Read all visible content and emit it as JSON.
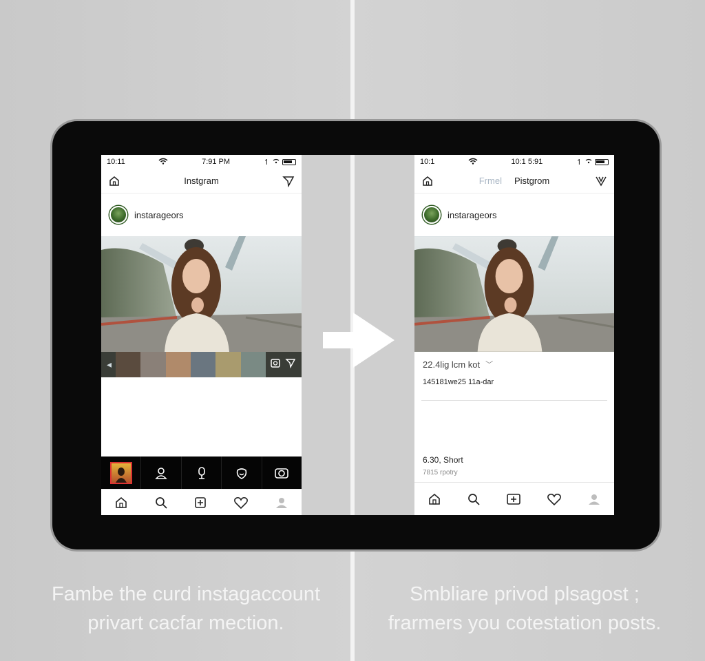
{
  "left_phone": {
    "status": {
      "time_left": "10:11",
      "time_center": "7:91 PM"
    },
    "appbar": {
      "title": "Instgram"
    },
    "profile": {
      "username": "instarageors"
    },
    "icons": {
      "home": "home-icon",
      "send": "send-icon"
    },
    "bottom_nav": [
      "home-icon",
      "search-icon",
      "add-post-icon",
      "heart-icon",
      "profile-icon"
    ],
    "story_bar": [
      "story-thumb",
      "person-icon",
      "mic-icon",
      "smile-icon",
      "camera-icon"
    ]
  },
  "right_phone": {
    "status": {
      "time_left": "10:1",
      "time_center": "10:1 5:91"
    },
    "appbar": {
      "tab_inactive": "Frmel",
      "title": "Pistgrom"
    },
    "profile": {
      "username": "instarageors"
    },
    "meta": {
      "likes": "22.4lig lcm kot",
      "caption": "145181we25 11a-dar"
    },
    "footer": {
      "time": "6.30, Short",
      "sub": "7815 rpotry"
    },
    "bottom_nav": [
      "home-icon",
      "search-icon",
      "add-post-icon",
      "heart-icon",
      "profile-icon"
    ]
  },
  "captions": {
    "left": "Fambe the curd instagaccount privart cacfar mection.",
    "right": "Smbliare privod plsagost ; frarmers you cotestation posts."
  },
  "colors": {
    "tablet": "#0a0a0a",
    "background": "#cfcfcf",
    "text_overlay": "#f4f4f4"
  }
}
